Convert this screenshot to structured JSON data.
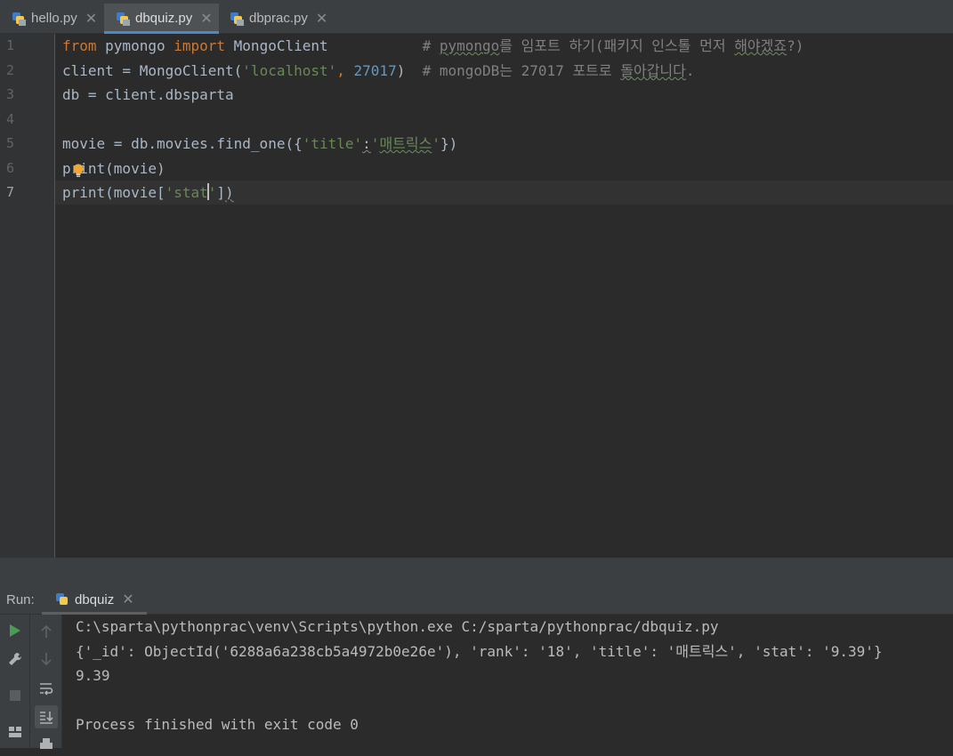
{
  "tabs": [
    {
      "label": "hello.py",
      "active": false
    },
    {
      "label": "dbquiz.py",
      "active": true
    },
    {
      "label": "dbprac.py",
      "active": false
    }
  ],
  "editor": {
    "line_numbers": [
      "1",
      "2",
      "3",
      "4",
      "5",
      "6",
      "7"
    ],
    "current_line": 7,
    "lines": {
      "l1": {
        "kw1": "from",
        "mod": " pymongo ",
        "kw2": "import",
        "cls": " MongoClient           ",
        "cmt_a": "# ",
        "cmt_b": "pymongo",
        "cmt_c": "를 임포트 하기(패키지 인스톨 먼저 ",
        "cmt_d": "해야겠죠",
        "cmt_e": "?)"
      },
      "l2": {
        "a": "client = MongoClient(",
        "str": "'localhost'",
        "b": ", ",
        "num": "27017",
        "c": ")  ",
        "cmt_a": "# mongoDB는 27017 포트로 ",
        "cmt_b": "돌아갑니다",
        "cmt_c": "."
      },
      "l3": {
        "a": "db = client.dbsparta"
      },
      "l5": {
        "a": "movie = db.movies.find_one({",
        "str1": "'title'",
        "colon": ":",
        "str2a": "'",
        "str2b": "매트릭스",
        "str2c": "'",
        "b": "})"
      },
      "l6": {
        "a": "print(movie)"
      },
      "l7": {
        "a": "print(movie[",
        "str_a": "'stat",
        "str_b": "'",
        "b": "]",
        "c": ")"
      }
    }
  },
  "run": {
    "label": "Run:",
    "tab_label": "dbquiz",
    "console": [
      "C:\\sparta\\pythonprac\\venv\\Scripts\\python.exe C:/sparta/pythonprac/dbquiz.py",
      "{'_id': ObjectId('6288a6a238cb5a4972b0e26e'), 'rank': '18', 'title': '매트릭스', 'stat': '9.39'}",
      "9.39",
      "",
      "Process finished with exit code 0"
    ]
  },
  "colors": {
    "background": "#2b2b2b",
    "keyword": "#cc7832",
    "string": "#6a8759",
    "number": "#6897bb",
    "comment": "#808080",
    "active_tab_underline": "#4a88c7",
    "run_green": "#499c54"
  },
  "icons": [
    "python-file-icon",
    "close-icon",
    "lightbulb-icon",
    "run-icon",
    "wrench-icon",
    "stop-icon",
    "layout-icon",
    "arrow-up-icon",
    "arrow-down-icon",
    "soft-wrap-icon",
    "scroll-to-end-icon",
    "print-icon"
  ]
}
